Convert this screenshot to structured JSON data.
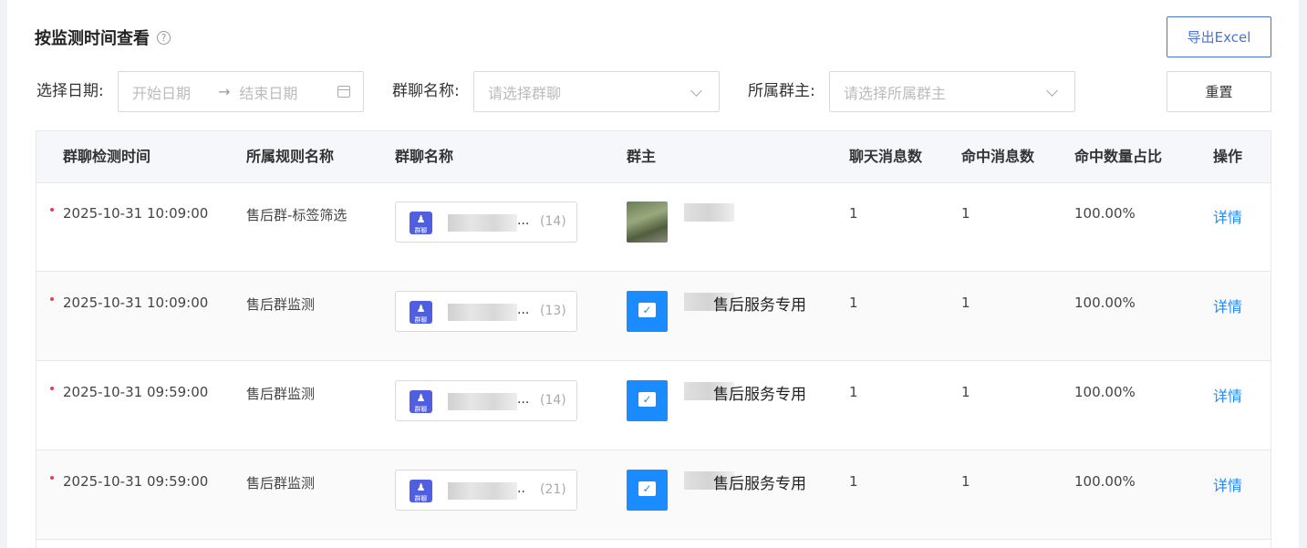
{
  "header": {
    "title": "按监测时间查看",
    "help_icon": "?",
    "export_label": "导出Excel",
    "reset_label": "重置"
  },
  "filters": {
    "date_label": "选择日期:",
    "start_placeholder": "开始日期",
    "arrow": "→",
    "end_placeholder": "结束日期",
    "group_label": "群聊名称:",
    "group_placeholder": "请选择群聊",
    "owner_label": "所属群主:",
    "owner_placeholder": "请选择所属群主"
  },
  "table": {
    "columns": [
      "群聊检测时间",
      "所属规则名称",
      "群聊名称",
      "群主",
      "聊天消息数",
      "命中消息数",
      "命中数量占比",
      "操作"
    ],
    "group_icon_text": "群聊",
    "rows": [
      {
        "time": "2025-10-31 10:09:00",
        "rule": "售后群-标签筛选",
        "group_suffix": "...",
        "group_count": "(14)",
        "owner_avatar": "photo",
        "owner_name": "",
        "chat_count": "1",
        "hit_count": "1",
        "ratio": "100.00%",
        "action": "详情"
      },
      {
        "time": "2025-10-31 10:09:00",
        "rule": "售后群监测",
        "group_suffix": "...",
        "group_count": "(13)",
        "owner_avatar": "chat",
        "owner_name": "售后服务专用",
        "chat_count": "1",
        "hit_count": "1",
        "ratio": "100.00%",
        "action": "详情"
      },
      {
        "time": "2025-10-31 09:59:00",
        "rule": "售后群监测",
        "group_suffix": "...",
        "group_count": "(14)",
        "owner_avatar": "chat",
        "owner_name": "售后服务专用",
        "chat_count": "1",
        "hit_count": "1",
        "ratio": "100.00%",
        "action": "详情"
      },
      {
        "time": "2025-10-31 09:59:00",
        "rule": "售后群监测",
        "group_suffix": "..",
        "group_count": "(21)",
        "owner_avatar": "chat",
        "owner_name": "售后服务专用",
        "chat_count": "1",
        "hit_count": "1",
        "ratio": "100.00%",
        "action": "详情"
      }
    ]
  }
}
